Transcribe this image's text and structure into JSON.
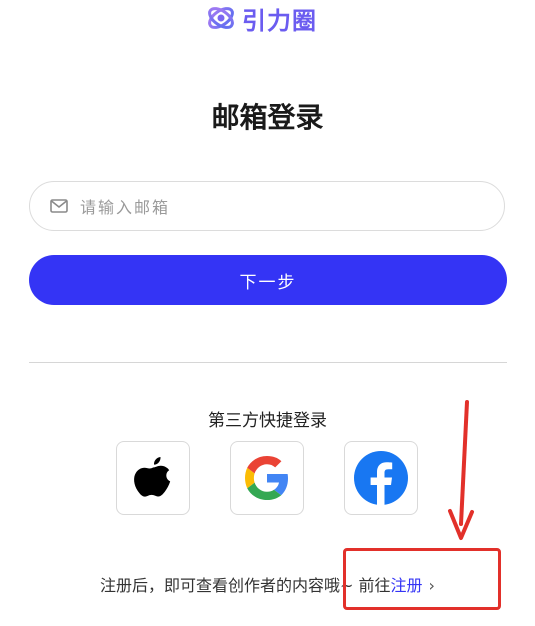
{
  "brand": {
    "name": "引力圈",
    "accent": "#6b5cf0"
  },
  "page": {
    "title": "邮箱登录"
  },
  "email": {
    "placeholder": "请输入邮箱",
    "value": "",
    "icon": "mail-icon"
  },
  "next_button": {
    "label": "下一步",
    "color": "#3434f5"
  },
  "third_party": {
    "title": "第三方快捷登录",
    "providers": [
      {
        "name": "Apple",
        "icon": "apple-icon"
      },
      {
        "name": "Google",
        "icon": "google-icon"
      },
      {
        "name": "Facebook",
        "icon": "facebook-icon"
      }
    ]
  },
  "footer": {
    "text": "注册后，即可查看创作者的内容哦~ 前往",
    "link": "注册",
    "chevron": "›"
  },
  "annotation": {
    "box_color": "#e2302a"
  }
}
